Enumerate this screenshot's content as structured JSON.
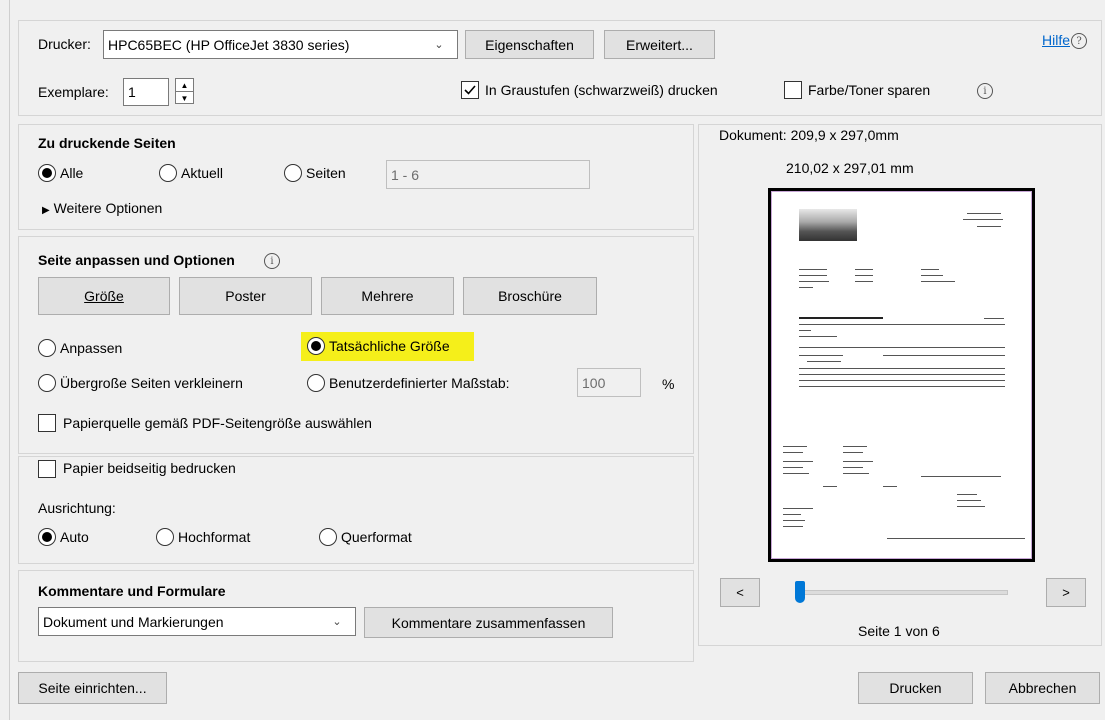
{
  "printer": {
    "label": "Drucker:",
    "value": "HPC65BEC (HP OfficeJet 3830 series)",
    "properties_btn": "Eigenschaften",
    "advanced_btn": "Erweitert...",
    "help_link": "Hilfe",
    "help_icon": "?"
  },
  "copies": {
    "label": "Exemplare:",
    "value": "1"
  },
  "grayscale": {
    "label": "In Graustufen (schwarzweiß) drucken",
    "checked": true
  },
  "save_ink": {
    "label": "Farbe/Toner sparen",
    "checked": false,
    "info_icon": "i"
  },
  "pages_section": {
    "title": "Zu druckende Seiten",
    "all": "Alle",
    "current": "Aktuell",
    "pages": "Seiten",
    "pages_value": "1 - 6",
    "more_options": "Weitere Optionen"
  },
  "sizing_section": {
    "title": "Seite anpassen und Optionen",
    "info_icon": "i",
    "buttons": [
      "Größe",
      "Poster",
      "Mehrere",
      "Broschüre"
    ],
    "fit": "Anpassen",
    "actual_size": "Tatsächliche Größe",
    "shrink": "Übergroße Seiten verkleinern",
    "custom_scale": "Benutzerdefinierter Maßstab:",
    "scale_value": "100",
    "percent": "%",
    "paper_source": "Papierquelle gemäß PDF-Seitengröße auswählen"
  },
  "duplex_section": {
    "duplex": "Papier beidseitig bedrucken",
    "orientation_label": "Ausrichtung:",
    "auto": "Auto",
    "portrait": "Hochformat",
    "landscape": "Querformat"
  },
  "comments_section": {
    "title": "Kommentare und Formulare",
    "value": "Dokument und Markierungen",
    "summarize_btn": "Kommentare zusammenfassen"
  },
  "preview": {
    "document_size": "Dokument: 209,9 x 297,0mm",
    "page_size": "210,02 x 297,01 mm",
    "prev": "<",
    "next": ">",
    "page_indicator": "Seite 1 von 6",
    "slider_position": 0.0
  },
  "footer": {
    "page_setup_btn": "Seite einrichten...",
    "print_btn": "Drucken",
    "cancel_btn": "Abbrechen"
  },
  "colors": {
    "highlight": "#f5ef1a",
    "link": "#0066cc",
    "slider_thumb": "#0078d7"
  }
}
